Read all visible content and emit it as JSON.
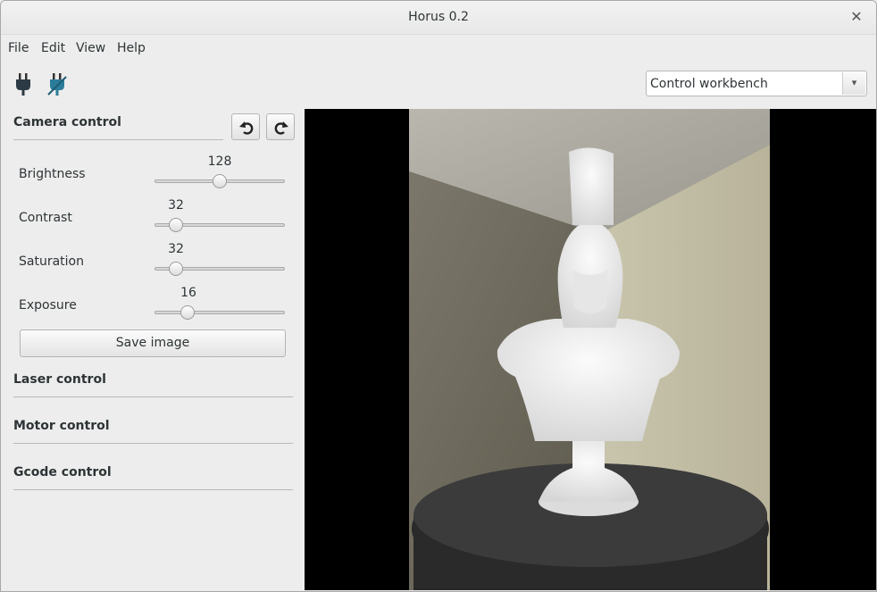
{
  "window": {
    "title": "Horus 0.2"
  },
  "menu": [
    "File",
    "Edit",
    "View",
    "Help"
  ],
  "toolbar": {
    "connect_icon": "plug-connect-icon",
    "disconnect_icon": "plug-disconnect-icon",
    "workbench": "Control workbench"
  },
  "panel": {
    "camera": {
      "title": "Camera control",
      "undo_icon": "undo-icon",
      "redo_icon": "redo-icon",
      "controls": [
        {
          "label": "Brightness",
          "value": "128",
          "fraction": 0.502
        },
        {
          "label": "Contrast",
          "value": "32",
          "fraction": 0.125
        },
        {
          "label": "Saturation",
          "value": "32",
          "fraction": 0.125
        },
        {
          "label": "Exposure",
          "value": "16",
          "fraction": 0.22
        }
      ],
      "save_label": "Save image"
    },
    "sections": [
      "Laser control",
      "Motor control",
      "Gcode control"
    ]
  },
  "colors": {
    "window_bg": "#ededed",
    "viewer_bg": "#000000",
    "icon_accent": "#2a7d9a"
  }
}
